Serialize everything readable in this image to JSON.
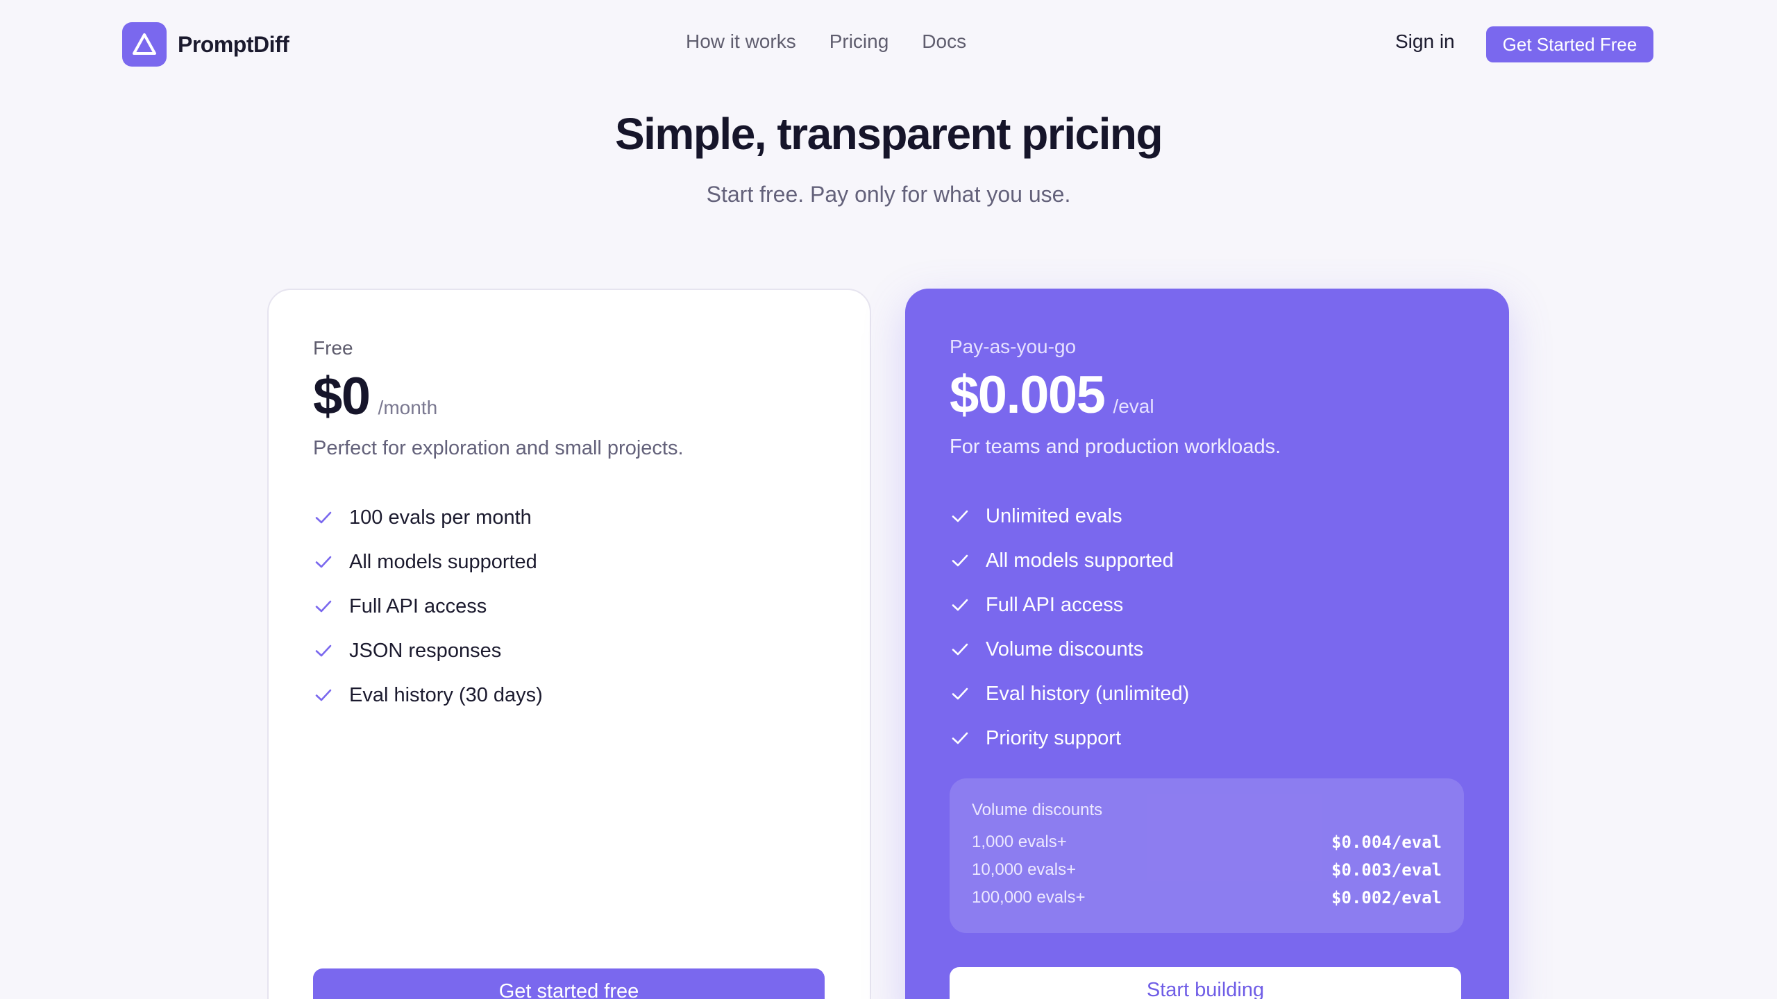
{
  "brand": {
    "name": "PromptDiff",
    "logo_icon": "triangle-icon",
    "accent": "#7a68ee"
  },
  "nav": {
    "links": [
      "How it works",
      "Pricing",
      "Docs"
    ],
    "sign_in": "Sign in",
    "cta": "Get Started Free"
  },
  "hero": {
    "title": "Simple, transparent pricing",
    "subtitle": "Start free. Pay only for what you use."
  },
  "plans": {
    "free": {
      "name": "Free",
      "price": "$0",
      "unit": "/month",
      "description": "Perfect for exploration and small projects.",
      "features": [
        "100 evals per month",
        "All models supported",
        "Full API access",
        "JSON responses",
        "Eval history (30 days)"
      ],
      "button": "Get started free",
      "feature_icon": "check-icon"
    },
    "paid": {
      "name": "Pay-as-you-go",
      "price": "$0.005",
      "unit": "/eval",
      "description": "For teams and production workloads.",
      "features": [
        "Unlimited evals",
        "All models supported",
        "Full API access",
        "Volume discounts",
        "Eval history (unlimited)",
        "Priority support"
      ],
      "volume": {
        "title": "Volume discounts",
        "tiers": [
          {
            "label": "1,000 evals+",
            "price": "$0.004/eval"
          },
          {
            "label": "10,000 evals+",
            "price": "$0.003/eval"
          },
          {
            "label": "100,000 evals+",
            "price": "$0.002/eval"
          }
        ]
      },
      "button": "Start building",
      "feature_icon": "check-icon",
      "card_color": "#7a68ee"
    }
  }
}
